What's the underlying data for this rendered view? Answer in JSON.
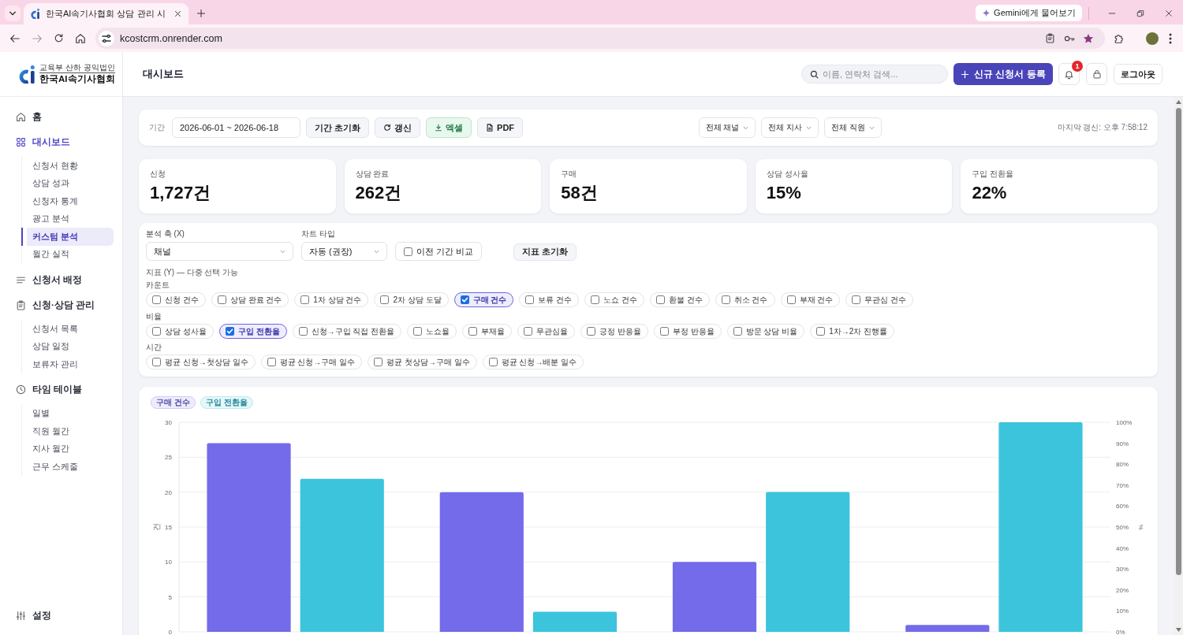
{
  "browser": {
    "tabs": [
      {
        "title": "한국AI속기사협회 상담 관리 시",
        "selected": true
      }
    ],
    "gemini_button": "Gemini에게 물어보기",
    "url": "kcostcrm.onrender.com"
  },
  "sidebar": {
    "logo": {
      "subtitle": "교육부 산하 공익법인",
      "name": "한국AI속기사협회"
    },
    "items": [
      {
        "label": "홈",
        "selected": false
      },
      {
        "label": "대시보드",
        "selected": true,
        "children": [
          {
            "label": "신청서 현황",
            "selected": false
          },
          {
            "label": "상담 성과",
            "selected": false
          },
          {
            "label": "신청자 통계",
            "selected": false
          },
          {
            "label": "광고 분석",
            "selected": false
          },
          {
            "label": "커스텀 분석",
            "selected": true
          },
          {
            "label": "월간 실적",
            "selected": false
          }
        ]
      },
      {
        "label": "신청서 배정",
        "selected": false
      },
      {
        "label": "신청·상담 관리",
        "selected": false,
        "children": [
          {
            "label": "신청서 목록",
            "selected": false
          },
          {
            "label": "상담 일정",
            "selected": false
          },
          {
            "label": "보류자 관리",
            "selected": false
          }
        ]
      },
      {
        "label": "타임 테이블",
        "selected": false,
        "children": [
          {
            "label": "일별",
            "selected": false
          },
          {
            "label": "직원 월간",
            "selected": false
          },
          {
            "label": "지사 월간",
            "selected": false
          },
          {
            "label": "근무 스케줄",
            "selected": false
          }
        ]
      }
    ],
    "footer_items": [
      {
        "label": "설정",
        "selected": false
      }
    ]
  },
  "header": {
    "title": "대시보드",
    "search": {
      "placeholder": "이름, 연락처 검색..."
    },
    "new_button": "신규 신청서 등록",
    "notifications": "1",
    "logout_button": "로그아웃"
  },
  "filter_bar": {
    "period_label": "기간",
    "date_range": "2026-06-01 ~ 2026-06-18",
    "buttons": [
      {
        "kind": "reset",
        "label": "기간 초기화"
      },
      {
        "kind": "refresh",
        "label": "갱신"
      },
      {
        "kind": "excel",
        "label": "엑셀"
      },
      {
        "kind": "pdf",
        "label": "PDF"
      }
    ],
    "filters": [
      "전체 채널",
      "전체 지사",
      "전체 직원"
    ],
    "last_updated": "마지막 갱신: 오후 7:58:12"
  },
  "stats": [
    {
      "label": "신청",
      "value": "1,727건"
    },
    {
      "label": "상담 완료",
      "value": "262건"
    },
    {
      "label": "구매",
      "value": "58건"
    },
    {
      "label": "상담 성사율",
      "value": "15%"
    },
    {
      "label": "구입 전환율",
      "value": "22%"
    }
  ],
  "analysis": {
    "x_axis": {
      "label": "분석 축 (X)",
      "value": "채널"
    },
    "chart_type": {
      "label": "차트 타입",
      "value": "자동 (권장)"
    },
    "compare": {
      "label": "이전 기간 비교",
      "checked": false
    },
    "reset_button": "지표 초기화",
    "metrics_title": "지표 (Y) — 다중 선택 가능",
    "groups": [
      {
        "name": "카운트",
        "metrics": [
          {
            "label": "신청 건수",
            "checked": false
          },
          {
            "label": "상담 완료 건수",
            "checked": false
          },
          {
            "label": "1차 상담 건수",
            "checked": false
          },
          {
            "label": "2차 상담 도달",
            "checked": false
          },
          {
            "label": "구매 건수",
            "checked": true
          },
          {
            "label": "보류 건수",
            "checked": false
          },
          {
            "label": "노쇼 건수",
            "checked": false
          },
          {
            "label": "환불 건수",
            "checked": false
          },
          {
            "label": "취소 건수",
            "checked": false
          },
          {
            "label": "부재 건수",
            "checked": false
          },
          {
            "label": "무관심 건수",
            "checked": false
          }
        ]
      },
      {
        "name": "비율",
        "metrics": [
          {
            "label": "상담 성사율",
            "checked": false
          },
          {
            "label": "구입 전환율",
            "checked": true
          },
          {
            "label": "신청→구입 직접 전환율",
            "checked": false
          },
          {
            "label": "노쇼율",
            "checked": false
          },
          {
            "label": "부재율",
            "checked": false
          },
          {
            "label": "무관심율",
            "checked": false
          },
          {
            "label": "긍정 반응율",
            "checked": false
          },
          {
            "label": "부정 반응율",
            "checked": false
          },
          {
            "label": "방문 상담 비율",
            "checked": false
          },
          {
            "label": "1차→2차 진행률",
            "checked": false
          }
        ]
      },
      {
        "name": "시간",
        "metrics": [
          {
            "label": "평균 신청→첫상담 일수",
            "checked": false
          },
          {
            "label": "평균 신청→구매 일수",
            "checked": false
          },
          {
            "label": "평균 첫상담→구매 일수",
            "checked": false
          },
          {
            "label": "평균 신청→배분 일수",
            "checked": false
          }
        ]
      }
    ]
  },
  "chart": {
    "chart_data": {
      "type": "bar",
      "grid": true,
      "ylabel": "건",
      "y2label": "%",
      "ylim": [
        0,
        30
      ],
      "yticks": [
        0,
        5,
        10,
        15,
        20,
        25,
        30
      ],
      "y2lim": [
        0,
        100
      ],
      "y2ticks": [
        {
          "value": 0,
          "label": "0%"
        },
        {
          "value": 10,
          "label": "10%"
        },
        {
          "value": 20,
          "label": "20%"
        },
        {
          "value": 30,
          "label": "30%"
        },
        {
          "value": 40,
          "label": "40%"
        },
        {
          "value": 50,
          "label": "50%"
        },
        {
          "value": 60,
          "label": "60%"
        },
        {
          "value": 70,
          "label": "70%"
        },
        {
          "value": 80,
          "label": "80%"
        },
        {
          "value": 90,
          "label": "90%"
        },
        {
          "value": 100,
          "label": "100%"
        }
      ],
      "series": [
        {
          "name": "구매 건수",
          "color": "#736be9",
          "values": [
            27,
            20,
            10,
            1
          ]
        },
        {
          "name": "구입 전환율",
          "color": "#3bc4dc",
          "axis": "y2",
          "values": [
            73,
            9.6,
            66.7,
            100
          ]
        }
      ]
    }
  }
}
